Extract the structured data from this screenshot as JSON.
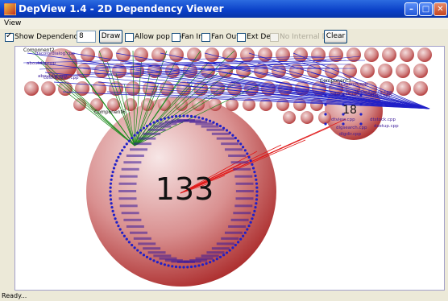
{
  "window": {
    "title": "DepView 1.4 - 2D Dependency Viewer",
    "minimize_icon": "minimize-icon",
    "maximize_icon": "maximize-icon",
    "close_icon": "close-icon"
  },
  "menu": {
    "items": [
      "View"
    ]
  },
  "toolbar": {
    "show_dependency_label": "Show Dependency",
    "show_dependency_checked": true,
    "depth_value": "8",
    "draw_label": "Draw",
    "allow_popup_label": "Allow pop up",
    "fan_in_label": "Fan In",
    "fan_out_label": "Fan Out",
    "ext_dep_label": "Ext Dep",
    "no_internal_dep_label": "No Internal Dep",
    "clear_label": "Clear"
  },
  "graph": {
    "big_count": "133",
    "right_count": "18",
    "component_labels": [
      "Component2",
      "Component3",
      "Component6"
    ],
    "file_labels_left": [
      "dacolordialog.cpp",
      "aboutdlg.cpp",
      "aboutdlg.cpp",
      "colorbutton.cpp"
    ],
    "file_labels_right": [
      "dirsearch.cpp",
      "dtlogdir.cpp",
      "dtshellparse.cpp",
      "dtlibs.cpp",
      "dtview.cpp",
      "dtstock.cpp",
      "dlgsearch.cpp",
      "dsetup.cpp",
      "dlgdir.cpp"
    ],
    "colors": {
      "blue_edge": "#2020c8",
      "green_edge": "#1c8a1c",
      "red_edge": "#e01818",
      "node_label": "#3a1a9a",
      "sphere_dark": "#b02a2a",
      "sphere_light": "#f6e4e4"
    }
  },
  "status": {
    "text": "Ready..."
  }
}
